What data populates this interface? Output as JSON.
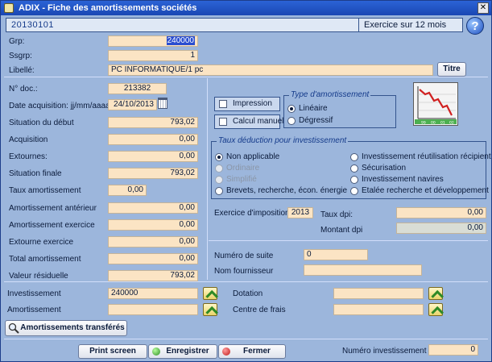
{
  "window": {
    "title": "ADIX - Fiche  des amortissements sociétés"
  },
  "header": {
    "code": "20130101",
    "exercice": "Exercice sur 12 mois"
  },
  "ident": {
    "grp_label": "Grp:",
    "grp_value": "240000",
    "ssgrp_label": "Ssgrp:",
    "ssgrp_value": "1",
    "libelle_label": "Libellé:",
    "libelle_value": "PC INFORMATIQUE/1 pc",
    "titre_button": "Titre"
  },
  "left": {
    "ndoc_label": "N° doc.:",
    "ndoc_value": "213382",
    "date_label": "Date acquisition: jj/mm/aaaa",
    "date_value": "24/10/2013",
    "rows": [
      {
        "label": "Situation du début",
        "value": "793,02"
      },
      {
        "label": "Acquisition",
        "value": "0,00"
      },
      {
        "label": "Extournes:",
        "value": "0,00"
      },
      {
        "label": "Situation finale",
        "value": "793,02"
      },
      {
        "label": "Taux amortissement",
        "value": "0,00"
      },
      {
        "label": "Amortissement antérieur",
        "value": "0,00"
      },
      {
        "label": "Amortissement exercice",
        "value": "0,00"
      },
      {
        "label": "Extourne exercice",
        "value": "0,00"
      },
      {
        "label": "Total amortissement",
        "value": "0,00"
      },
      {
        "label": "Valeur résiduelle",
        "value": "793,02"
      }
    ]
  },
  "options": {
    "impression": "Impression",
    "calcul_manuel": "Calcul manuel"
  },
  "type_amort": {
    "legend": "Type d'amortissement",
    "lineaire": "Linéaire",
    "degressif": "Dégressif"
  },
  "taux": {
    "legend": "Taux déduction pour investissement",
    "left": [
      "Non applicable",
      "Ordinaire",
      "Simplifié",
      "Brevets, recherche, écon. énergie"
    ],
    "right": [
      "Investissement réutilisation récipient",
      "Sécurisation",
      "Investissement navires",
      "Etalée recherche et développement"
    ]
  },
  "imposition": {
    "exercice_label": "Exercice d'imposition",
    "exercice_value": "2013",
    "taux_dpi_label": "Taux dpi:",
    "taux_dpi_value": "0,00",
    "montant_dpi_label": "Montant dpi",
    "montant_dpi_value": "0,00"
  },
  "suite": {
    "numero_label": "Numéro de suite",
    "numero_value": "0",
    "fournisseur_label": "Nom fournisseur",
    "fournisseur_value": ""
  },
  "links": {
    "investissement_label": "Investissement",
    "investissement_value": "240000",
    "amortissement_label": "Amortissement",
    "amortissement_value": "",
    "dotation_label": "Dotation",
    "dotation_value": "",
    "centre_label": "Centre de frais",
    "centre_value": ""
  },
  "transfer_button": "Amortissements transférés",
  "footer": {
    "print": "Print screen",
    "save": "Enregistrer",
    "close": "Fermer",
    "num_inv_label": "Numéro investissement",
    "num_inv_value": "0"
  },
  "chart_icon": {
    "ticks": [
      "99",
      "00",
      "01",
      "02"
    ]
  },
  "colors": {
    "field_bg": "#fbe4c4",
    "panel_bg": "#9cb6dc",
    "title_bg": "#1a47b3",
    "accent_red": "#d02020",
    "accent_green": "#2e8a26"
  }
}
